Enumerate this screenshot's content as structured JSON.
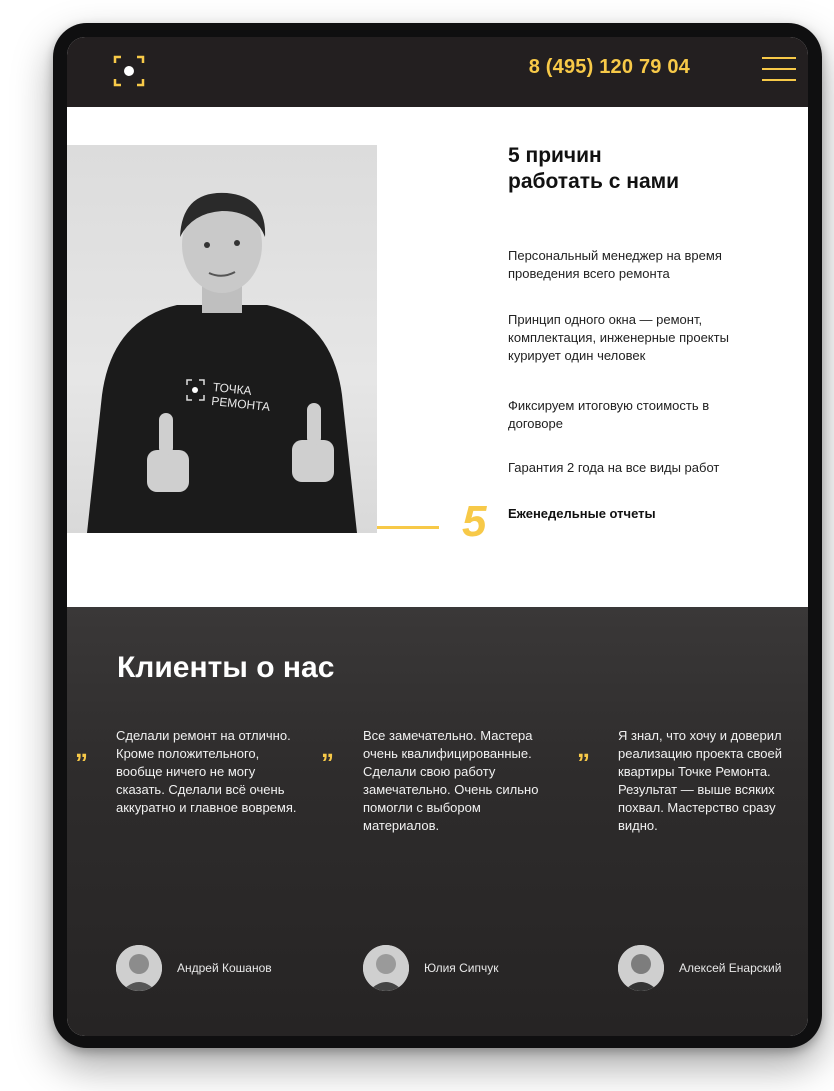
{
  "header": {
    "phone": "8 (495) 120 79 04",
    "logo_icon": "focus-dot-logo-icon",
    "menu_icon": "hamburger-menu-icon"
  },
  "colors": {
    "accent": "#f7c948",
    "header_bg": "#231f20",
    "reviews_bg": "#2e2c2c"
  },
  "reasons": {
    "title_line1": "5 причин",
    "title_line2": "работать с нами",
    "active_number": "5",
    "items": [
      {
        "text": "Персональный менеджер на время проведения всего ремонта"
      },
      {
        "text": "Принцип одного окна — ремонт, комплектация, инженерные проекты курирует один человек"
      },
      {
        "text": "Фиксируем итоговую стоимость в договоре"
      },
      {
        "text": "Гарантия 2 года на все виды работ"
      },
      {
        "text": "Еженедельные отчеты"
      }
    ],
    "photo_shirt_line1": "ТОЧКА",
    "photo_shirt_line2": "РЕМОНТА"
  },
  "reviews": {
    "title": "Клиенты о нас",
    "quote_mark": "„",
    "items": [
      {
        "text": "Сделали ремонт на отлично. Кроме положительного, вообще ничего не могу сказать. Сделали всё очень аккуратно и главное вовремя.",
        "author": "Андрей Кошанов"
      },
      {
        "text": "Все замечательно. Мастера очень квалифицированные. Сделали свою работу замечательно. Очень сильно помогли с выбором материалов.",
        "author": "Юлия Сипчук"
      },
      {
        "text": "Я знал, что хочу и доверил реализацию проекта своей квартиры Точке Ремонта. Результат — выше всяких похвал. Мастерство сразу видно.",
        "author": "Алексей Енарский"
      }
    ]
  }
}
